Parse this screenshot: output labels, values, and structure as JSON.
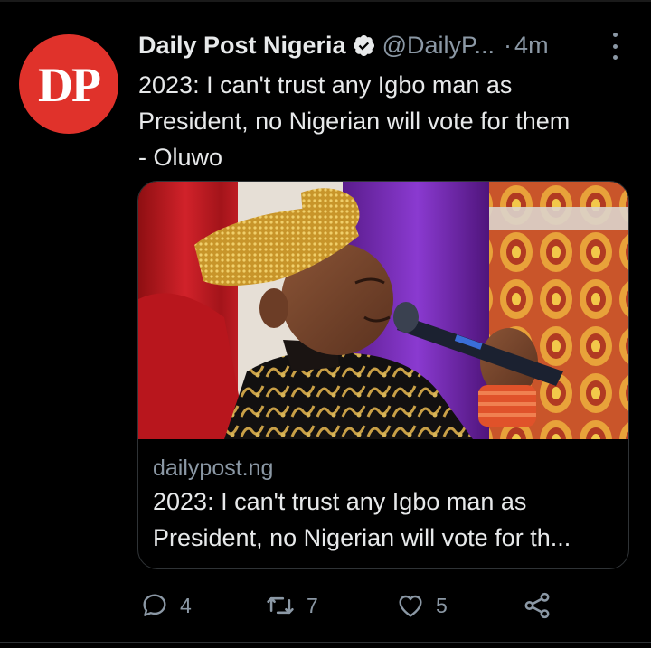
{
  "account": {
    "avatar_text": "DP",
    "display_name": "Daily Post Nigeria",
    "handle": "@DailyP...",
    "separator": "·",
    "time": "4m"
  },
  "tweet": {
    "text_lines": [
      "2023: I can't trust any Igbo man as",
      "President, no Nigerian will vote for them",
      "- Oluwo"
    ]
  },
  "card": {
    "domain": "dailypost.ng",
    "title_lines": [
      "2023: I can't trust any Igbo man as",
      "President, no Nigerian will vote for th..."
    ]
  },
  "actions": {
    "reply_count": "4",
    "retweet_count": "7",
    "like_count": "5"
  },
  "icons": {
    "verified": "verified-badge-icon",
    "more": "more-dots-icon",
    "reply": "reply-bubble-icon",
    "retweet": "retweet-arrows-icon",
    "like": "heart-icon",
    "share": "share-nodes-icon"
  },
  "colors": {
    "background": "#000000",
    "text_primary": "#e7e9ea",
    "text_secondary": "#8b98a5",
    "avatar_red": "#e0322b",
    "border": "#2f3336"
  }
}
